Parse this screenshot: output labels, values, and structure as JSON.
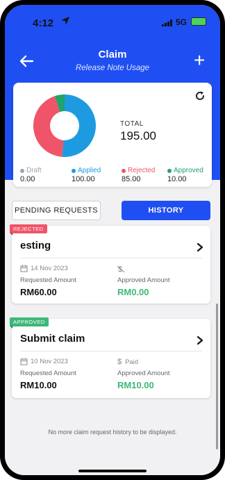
{
  "status_bar": {
    "time": "4:12",
    "network": "5G",
    "location_icon": "location-arrow-icon"
  },
  "header": {
    "title": "Claim",
    "subtitle": "Release Note Usage",
    "back_icon": "arrow-left-icon",
    "add_icon": "plus-icon"
  },
  "summary": {
    "total_label": "TOTAL",
    "total_value": "195.00",
    "refresh_icon": "refresh-icon",
    "legend": [
      {
        "label": "Draft",
        "value": "0.00",
        "color": "#9aa6b2"
      },
      {
        "label": "Applied",
        "value": "100.00",
        "color": "#1e9be0"
      },
      {
        "label": "Rejected",
        "value": "85.00",
        "color": "#f05468"
      },
      {
        "label": "Approved",
        "value": "10.00",
        "color": "#21a36b"
      }
    ]
  },
  "chart_data": {
    "type": "pie",
    "categories": [
      "Draft",
      "Applied",
      "Rejected",
      "Approved"
    ],
    "values": [
      0,
      100,
      85,
      10
    ]
  },
  "tabs": {
    "pending": "PENDING REQUESTS",
    "history": "HISTORY",
    "active": "history"
  },
  "claims": [
    {
      "status": "REJECTED",
      "title": "esting",
      "date": "14 Nov 2023",
      "payment_status": "",
      "requested_label": "Requested Amount",
      "requested_amount": "RM60.00",
      "approved_label": "Approved Amount",
      "approved_amount": "RM0.00"
    },
    {
      "status": "APPROVED",
      "title": "Submit claim",
      "date": "10 Nov 2023",
      "payment_status": "Paid",
      "requested_label": "Requested Amount",
      "requested_amount": "RM10.00",
      "approved_label": "Approved Amount",
      "approved_amount": "RM10.00"
    }
  ],
  "footer_note": "No more claim request history to be displayed."
}
